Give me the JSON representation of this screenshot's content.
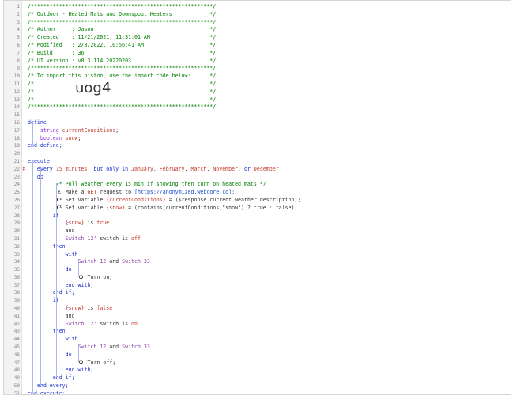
{
  "import_code": "uog4",
  "lines": [
    {
      "n": "1",
      "segs": [
        {
          "t": "/**********************************************************/",
          "c": "cm"
        }
      ]
    },
    {
      "n": "2",
      "segs": [
        {
          "t": "/* Outdoor - Heated Mats and Downspout Heaters            */",
          "c": "cm"
        }
      ]
    },
    {
      "n": "3",
      "segs": [
        {
          "t": "/**********************************************************/",
          "c": "cm"
        }
      ]
    },
    {
      "n": "4",
      "segs": [
        {
          "t": "/* Author     : Jason                                     */",
          "c": "cm"
        }
      ]
    },
    {
      "n": "5",
      "segs": [
        {
          "t": "/* Created    : 11/21/2021, 11:31:01 AM                   */",
          "c": "cm"
        }
      ]
    },
    {
      "n": "6",
      "segs": [
        {
          "t": "/* Modified   : 2/8/2022, 10:56:41 AM                     */",
          "c": "cm"
        }
      ]
    },
    {
      "n": "7",
      "segs": [
        {
          "t": "/* Build      : 36                                        */",
          "c": "cm"
        }
      ]
    },
    {
      "n": "8",
      "segs": [
        {
          "t": "/* UI version : v0.3.114.20220203                         */",
          "c": "cm"
        }
      ]
    },
    {
      "n": "9",
      "segs": [
        {
          "t": "/**********************************************************/",
          "c": "cm"
        }
      ]
    },
    {
      "n": "10",
      "segs": [
        {
          "t": "/* To import this piston, use the import code below:      */",
          "c": "cm"
        }
      ]
    },
    {
      "n": "11",
      "segs": [
        {
          "t": "/*                                                        */",
          "c": "cm"
        }
      ]
    },
    {
      "n": "12",
      "segs": [
        {
          "t": "/*                                                        */",
          "c": "cm"
        }
      ]
    },
    {
      "n": "13",
      "segs": [
        {
          "t": "/*                                                        */",
          "c": "cm"
        }
      ]
    },
    {
      "n": "14",
      "segs": [
        {
          "t": "/**********************************************************/",
          "c": "cm"
        }
      ]
    },
    {
      "n": "15",
      "segs": []
    },
    {
      "n": "16",
      "segs": [
        {
          "t": "define",
          "c": "kw"
        }
      ]
    },
    {
      "n": "17",
      "segs": [
        {
          "t": "    string ",
          "c": "ty"
        },
        {
          "t": "currentConditions",
          "c": "vr"
        },
        {
          "t": ";",
          "c": "op"
        }
      ]
    },
    {
      "n": "18",
      "segs": [
        {
          "t": "    boolean ",
          "c": "ty"
        },
        {
          "t": "snow",
          "c": "vr"
        },
        {
          "t": ";",
          "c": "op"
        }
      ]
    },
    {
      "n": "19",
      "segs": [
        {
          "t": "end define;",
          "c": "kw"
        }
      ]
    },
    {
      "n": "20",
      "segs": []
    },
    {
      "n": "21",
      "segs": [
        {
          "t": "execute",
          "c": "kw"
        }
      ]
    },
    {
      "n": "22",
      "mk": "‡",
      "segs": [
        {
          "t": "   every ",
          "c": "kw"
        },
        {
          "t": "15 minutes",
          "c": "st"
        },
        {
          "t": ", but only in ",
          "c": "kw"
        },
        {
          "t": "January",
          "c": "st"
        },
        {
          "t": ", ",
          "c": "op"
        },
        {
          "t": "February",
          "c": "st"
        },
        {
          "t": ", ",
          "c": "op"
        },
        {
          "t": "March",
          "c": "st"
        },
        {
          "t": ", ",
          "c": "op"
        },
        {
          "t": "November",
          "c": "st"
        },
        {
          "t": ", or ",
          "c": "kw"
        },
        {
          "t": "December",
          "c": "st"
        }
      ]
    },
    {
      "n": "23",
      "segs": [
        {
          "t": "   do",
          "c": "kw"
        }
      ]
    },
    {
      "n": "24",
      "segs": [
        {
          "t": "         /* Poll weather every 15 min if snowing then turn on heated mats */",
          "c": "cm"
        }
      ]
    },
    {
      "n": "25",
      "segs": [
        {
          "t": "         ",
          "c": "op"
        },
        {
          "t": "⚓",
          "c": "ic"
        },
        {
          "t": " Make a ",
          "c": "cd"
        },
        {
          "t": "GET",
          "c": "st"
        },
        {
          "t": " request to ",
          "c": "cd"
        },
        {
          "t": "[https://anonymized.webcore.co]",
          "c": "lk"
        },
        {
          "t": ";",
          "c": "cd"
        }
      ]
    },
    {
      "n": "26",
      "segs": [
        {
          "t": "         ",
          "c": "op"
        },
        {
          "t": "X¹",
          "c": "ic"
        },
        {
          "t": " Set variable ",
          "c": "cd"
        },
        {
          "t": "{currentConditions}",
          "c": "vr"
        },
        {
          "t": " = ($response.current.weather.description);",
          "c": "cd"
        }
      ]
    },
    {
      "n": "27",
      "segs": [
        {
          "t": "         ",
          "c": "op"
        },
        {
          "t": "X¹",
          "c": "ic"
        },
        {
          "t": " Set variable ",
          "c": "cd"
        },
        {
          "t": "{snow}",
          "c": "vr"
        },
        {
          "t": " = (contains(currentConditions,\"snow\") ? true : false);",
          "c": "cd"
        }
      ]
    },
    {
      "n": "28",
      "segs": [
        {
          "t": "        if",
          "c": "kw"
        }
      ]
    },
    {
      "n": "29",
      "segs": [
        {
          "t": "            ",
          "c": "op"
        },
        {
          "t": "{snow}",
          "c": "vr"
        },
        {
          "t": " is ",
          "c": "cd"
        },
        {
          "t": "true",
          "c": "st"
        }
      ]
    },
    {
      "n": "30",
      "segs": [
        {
          "t": "            and",
          "c": "cd"
        }
      ]
    },
    {
      "n": "31",
      "segs": [
        {
          "t": "            ",
          "c": "op"
        },
        {
          "t": "Switch 12'",
          "c": "dv"
        },
        {
          "t": " switch is ",
          "c": "cd"
        },
        {
          "t": "off",
          "c": "st"
        }
      ]
    },
    {
      "n": "32",
      "segs": [
        {
          "t": "        then",
          "c": "kw"
        }
      ]
    },
    {
      "n": "33",
      "segs": [
        {
          "t": "            with",
          "c": "kw"
        }
      ]
    },
    {
      "n": "34",
      "segs": [
        {
          "t": "                ",
          "c": "op"
        },
        {
          "t": "Switch 12",
          "c": "dv"
        },
        {
          "t": " and ",
          "c": "cd"
        },
        {
          "t": "Switch 33",
          "c": "dv"
        }
      ]
    },
    {
      "n": "35",
      "segs": [
        {
          "t": "            do",
          "c": "kw"
        }
      ]
    },
    {
      "n": "36",
      "segs": [
        {
          "t": "                ",
          "c": "op"
        },
        {
          "t": "⏻",
          "c": "ic"
        },
        {
          "t": " Turn on;",
          "c": "cd"
        }
      ]
    },
    {
      "n": "37",
      "segs": [
        {
          "t": "            end with;",
          "c": "kw"
        }
      ]
    },
    {
      "n": "38",
      "segs": [
        {
          "t": "        end if;",
          "c": "kw"
        }
      ]
    },
    {
      "n": "39",
      "segs": [
        {
          "t": "        if",
          "c": "kw"
        }
      ]
    },
    {
      "n": "40",
      "segs": [
        {
          "t": "            ",
          "c": "op"
        },
        {
          "t": "{snow}",
          "c": "vr"
        },
        {
          "t": " is ",
          "c": "cd"
        },
        {
          "t": "false",
          "c": "st"
        }
      ]
    },
    {
      "n": "41",
      "segs": [
        {
          "t": "            and",
          "c": "cd"
        }
      ]
    },
    {
      "n": "42",
      "segs": [
        {
          "t": "            ",
          "c": "op"
        },
        {
          "t": "Switch 12'",
          "c": "dv"
        },
        {
          "t": " switch is ",
          "c": "cd"
        },
        {
          "t": "on",
          "c": "st"
        }
      ]
    },
    {
      "n": "43",
      "segs": [
        {
          "t": "        then",
          "c": "kw"
        }
      ]
    },
    {
      "n": "44",
      "segs": [
        {
          "t": "            with",
          "c": "kw"
        }
      ]
    },
    {
      "n": "45",
      "segs": [
        {
          "t": "                ",
          "c": "op"
        },
        {
          "t": "Switch 12",
          "c": "dv"
        },
        {
          "t": " and ",
          "c": "cd"
        },
        {
          "t": "Switch 33",
          "c": "dv"
        }
      ]
    },
    {
      "n": "46",
      "segs": [
        {
          "t": "            do",
          "c": "kw"
        }
      ]
    },
    {
      "n": "47",
      "segs": [
        {
          "t": "                ",
          "c": "op"
        },
        {
          "t": "⏻",
          "c": "ic"
        },
        {
          "t": " Turn off;",
          "c": "cd"
        }
      ]
    },
    {
      "n": "48",
      "segs": [
        {
          "t": "            end with;",
          "c": "kw"
        }
      ]
    },
    {
      "n": "49",
      "segs": [
        {
          "t": "        end if;",
          "c": "kw"
        }
      ]
    },
    {
      "n": "50",
      "segs": [
        {
          "t": "   end every;",
          "c": "kw"
        }
      ]
    },
    {
      "n": "51",
      "segs": [
        {
          "t": "end execute;",
          "c": "kw"
        }
      ]
    }
  ]
}
